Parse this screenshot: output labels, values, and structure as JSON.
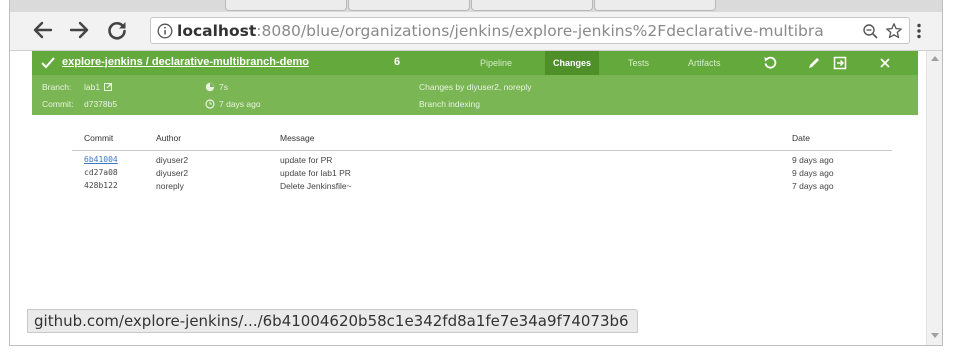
{
  "browser": {
    "url_info_icon": "info-icon",
    "url_host": "localhost",
    "url_rest": ":8080/blue/organizations/jenkins/explore-jenkins%2Fdeclarative-multibra",
    "status_url": "github.com/explore-jenkins/.../6b41004620b58c1e342fd8a1fe7e34a9f74073b6"
  },
  "header": {
    "job_title": "explore-jenkins / declarative-multibranch-demo",
    "run_number": "6",
    "tabs": [
      {
        "label": "Pipeline",
        "active": false
      },
      {
        "label": "Changes",
        "active": true
      },
      {
        "label": "Tests",
        "active": false
      },
      {
        "label": "Artifacts",
        "active": false
      }
    ],
    "accent_color": "#64a93b"
  },
  "summary": {
    "branch_label": "Branch:",
    "branch_value": "lab1",
    "commit_label": "Commit:",
    "commit_value": "d7378b5",
    "duration": "7s",
    "started": "7 days ago",
    "changes": "Changes by diyuser2, noreply",
    "cause": "Branch indexing"
  },
  "changes_table": {
    "columns": [
      "Commit",
      "Author",
      "Message",
      "Date"
    ],
    "rows": [
      {
        "commit": "6b41004",
        "author": "diyuser2",
        "message": "update for PR",
        "date": "9 days ago"
      },
      {
        "commit": "cd27a08",
        "author": "diyuser2",
        "message": "update for lab1 PR",
        "date": "9 days ago"
      },
      {
        "commit": "428b122",
        "author": "noreply",
        "message": "Delete Jenkinsfile~",
        "date": "7 days ago"
      }
    ]
  }
}
